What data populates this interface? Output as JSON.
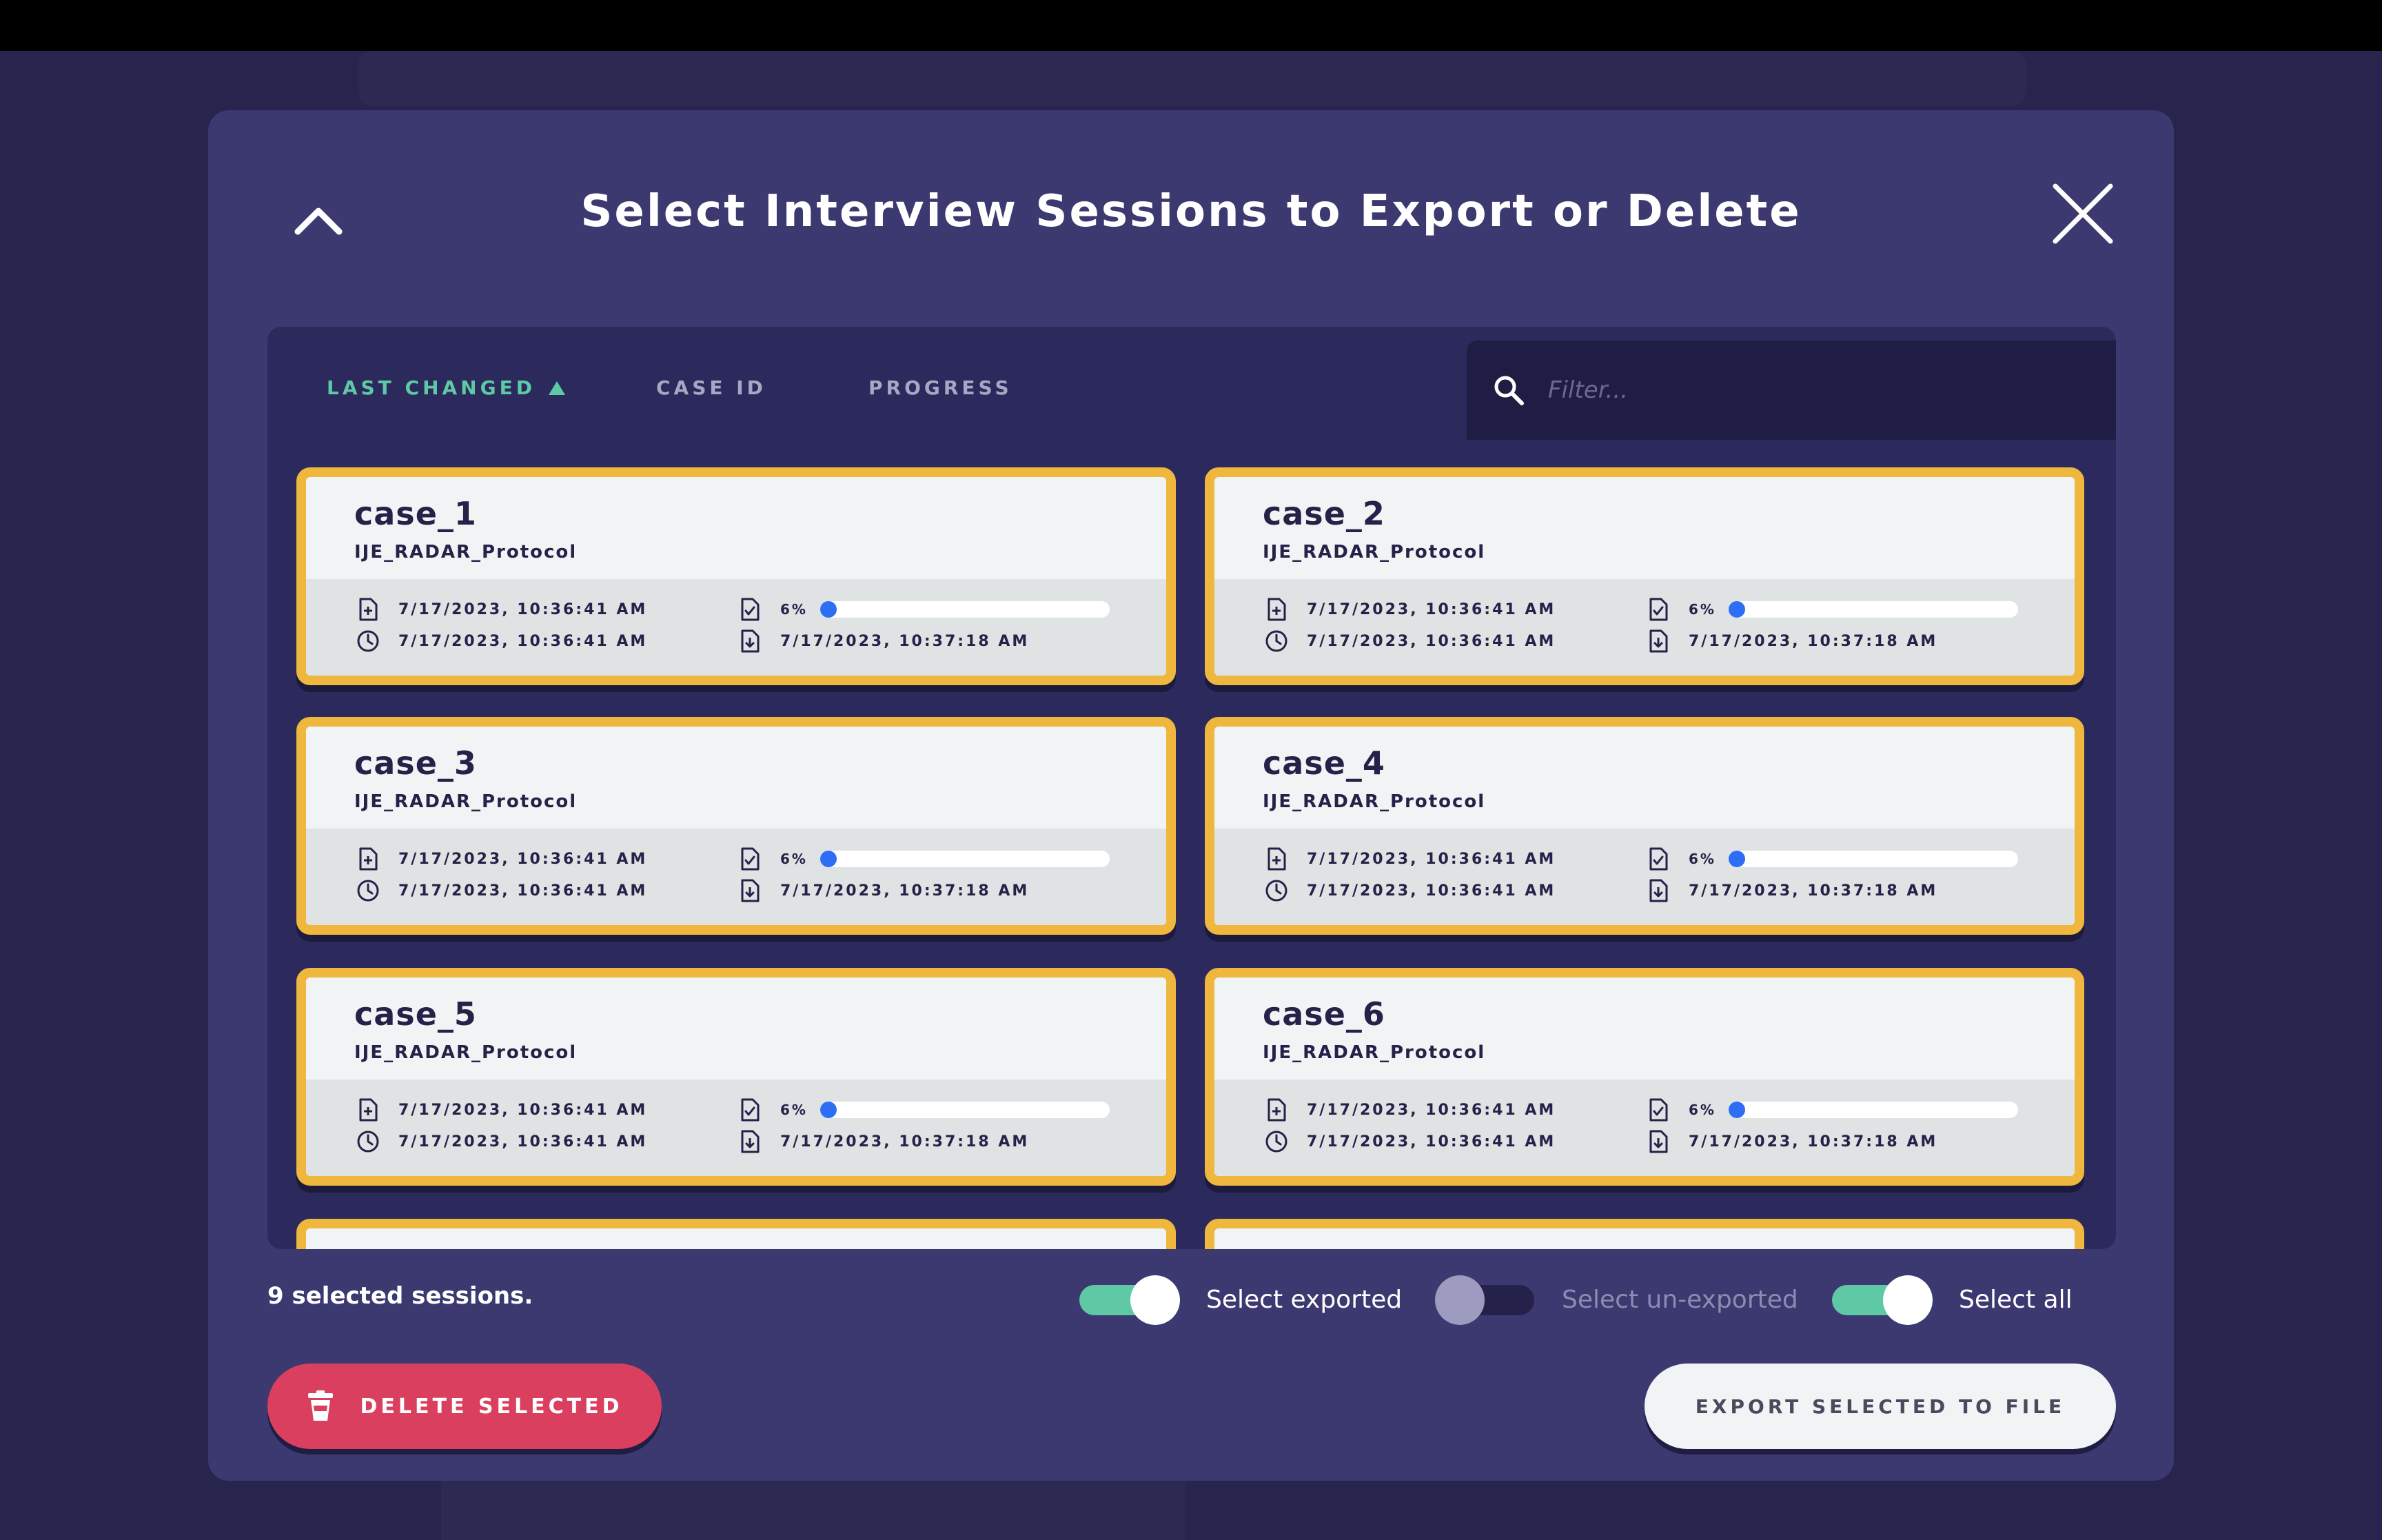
{
  "modal": {
    "title": "Select Interview Sessions to Export or Delete"
  },
  "sort_tabs": [
    {
      "label": "LAST CHANGED",
      "active": true,
      "direction": "ascending"
    },
    {
      "label": "CASE ID",
      "active": false
    },
    {
      "label": "PROGRESS",
      "active": false
    }
  ],
  "filter": {
    "placeholder": "Filter..."
  },
  "sessions": [
    {
      "case": "case_1",
      "protocol": "IJE_RADAR_Protocol",
      "created": "7/17/2023, 10:36:41 AM",
      "modified": "7/17/2023, 10:36:41 AM",
      "progress_label": "6%",
      "progress": 0.06,
      "exported": "7/17/2023, 10:37:18 AM",
      "selected": true
    },
    {
      "case": "case_2",
      "protocol": "IJE_RADAR_Protocol",
      "created": "7/17/2023, 10:36:41 AM",
      "modified": "7/17/2023, 10:36:41 AM",
      "progress_label": "6%",
      "progress": 0.06,
      "exported": "7/17/2023, 10:37:18 AM",
      "selected": true
    },
    {
      "case": "case_3",
      "protocol": "IJE_RADAR_Protocol",
      "created": "7/17/2023, 10:36:41 AM",
      "modified": "7/17/2023, 10:36:41 AM",
      "progress_label": "6%",
      "progress": 0.06,
      "exported": "7/17/2023, 10:37:18 AM",
      "selected": true
    },
    {
      "case": "case_4",
      "protocol": "IJE_RADAR_Protocol",
      "created": "7/17/2023, 10:36:41 AM",
      "modified": "7/17/2023, 10:36:41 AM",
      "progress_label": "6%",
      "progress": 0.06,
      "exported": "7/17/2023, 10:37:18 AM",
      "selected": true
    },
    {
      "case": "case_5",
      "protocol": "IJE_RADAR_Protocol",
      "created": "7/17/2023, 10:36:41 AM",
      "modified": "7/17/2023, 10:36:41 AM",
      "progress_label": "6%",
      "progress": 0.06,
      "exported": "7/17/2023, 10:37:18 AM",
      "selected": true
    },
    {
      "case": "case_6",
      "protocol": "IJE_RADAR_Protocol",
      "created": "7/17/2023, 10:36:41 AM",
      "modified": "7/17/2023, 10:36:41 AM",
      "progress_label": "6%",
      "progress": 0.06,
      "exported": "7/17/2023, 10:37:18 AM",
      "selected": true
    }
  ],
  "footer": {
    "selected_count": "9 selected sessions.",
    "toggles": [
      {
        "label": "Select exported",
        "on": true
      },
      {
        "label": "Select un-exported",
        "on": false
      },
      {
        "label": "Select all",
        "on": true
      }
    ],
    "delete_label": "DELETE SELECTED",
    "export_label": "EXPORT SELECTED TO FILE"
  },
  "colors": {
    "modal_bg": "#3b3970",
    "panel_bg": "#2c2a5c",
    "card_border": "#f0b73f",
    "active_tab": "#5ec9a4",
    "toggle_on": "#5ec9a4",
    "progress_fill": "#2d6ef5",
    "delete": "#da3f5f"
  }
}
